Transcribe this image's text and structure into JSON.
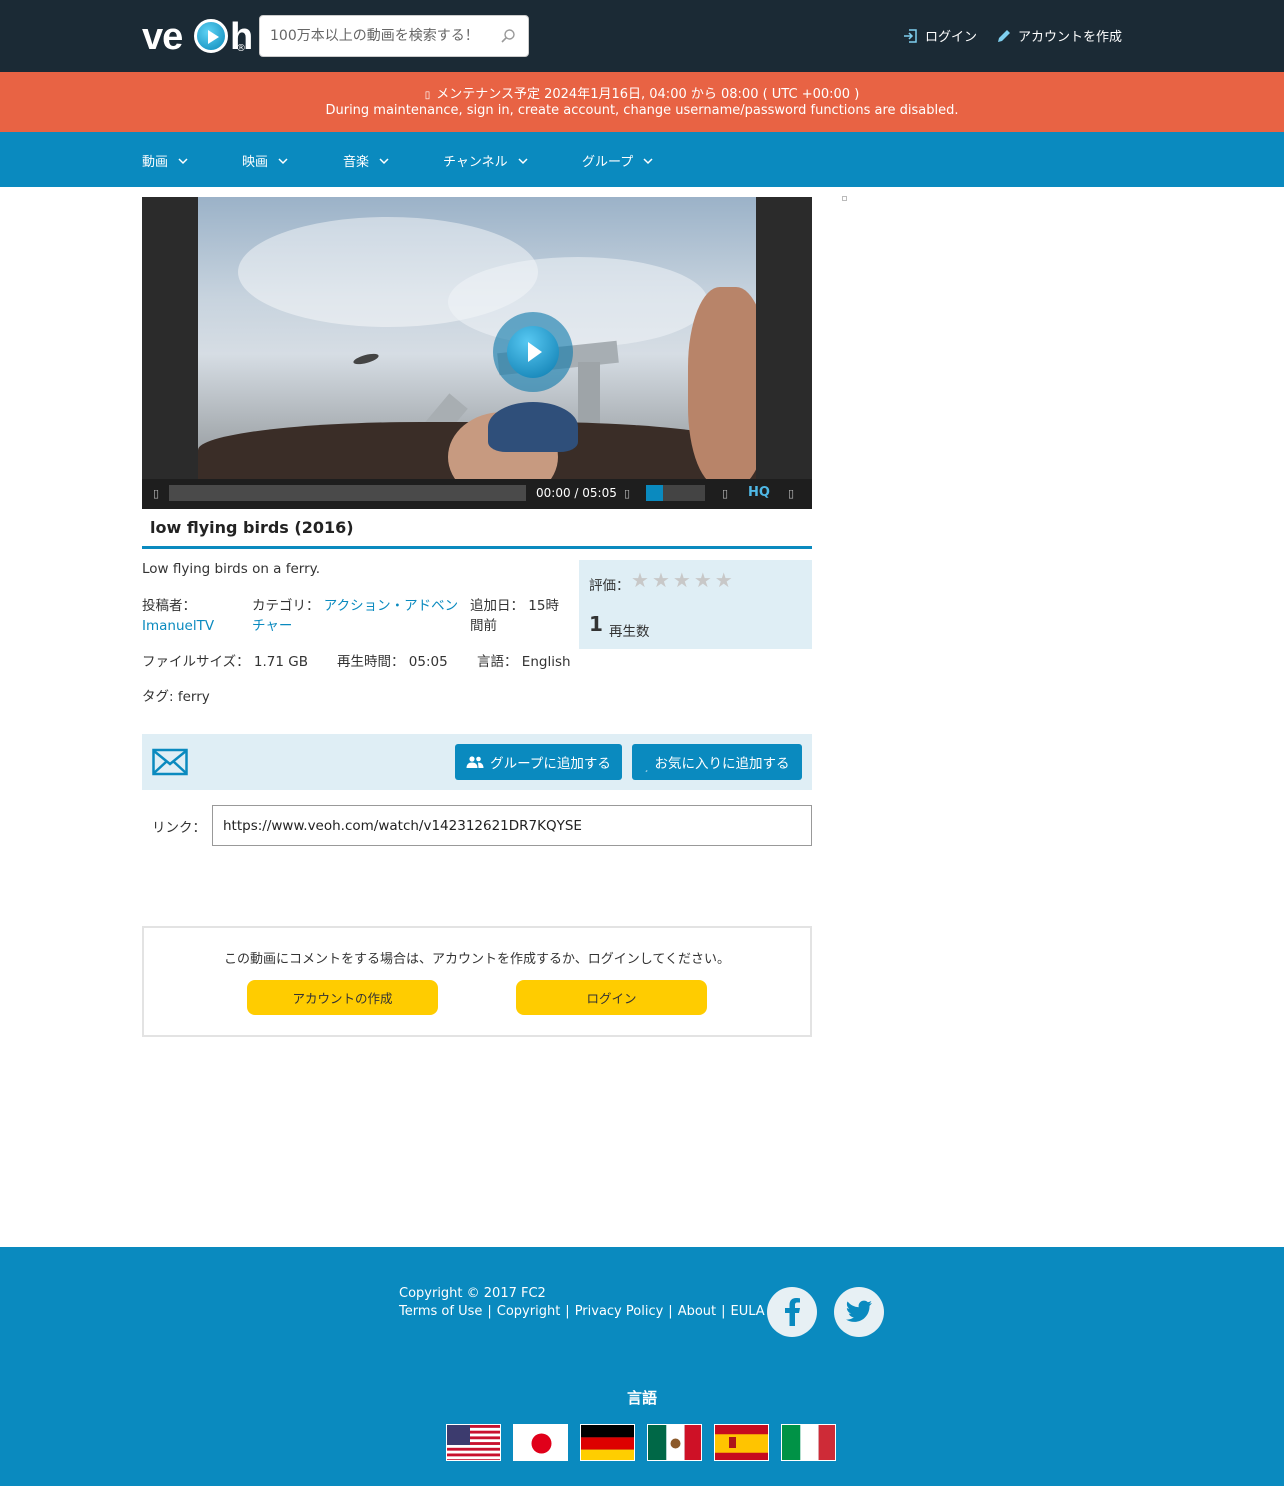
{
  "header": {
    "logo_text": "ve",
    "logo_text_end": "h",
    "logo_reg": "®",
    "search_placeholder": "100万本以上の動画を検索する！",
    "login_label": "ログイン",
    "signup_label": "アカウントを作成"
  },
  "maintenance": {
    "line1": "メンテナンス予定 2024年1月16日, 04:00 から 08:00 ( UTC +00:00 )",
    "line2": "During maintenance, sign in, create account, change username/password functions are disabled."
  },
  "nav": {
    "items": [
      {
        "label": "動画"
      },
      {
        "label": "映画"
      },
      {
        "label": "音楽"
      },
      {
        "label": "チャンネル"
      },
      {
        "label": "グループ"
      }
    ]
  },
  "player": {
    "time": "00:00 / 05:05",
    "hq_label": "HQ",
    "volume_fraction": 0.28,
    "progress_fraction": 0
  },
  "video": {
    "title": "low flying birds (2016)",
    "description": "Low flying birds on a ferry.",
    "uploader_label": "投稿者：",
    "uploader": "ImanuelTV",
    "category_label": "カテゴリ：",
    "category_line1": "アクション・アドベン",
    "category_line2": "チャー",
    "added_label": "追加日：",
    "added_line1": "15時",
    "added_line2": "間前",
    "filesize_label": "ファイルサイズ：",
    "filesize": "1.71 GB",
    "duration_label": "再生時間：",
    "duration": "05:05",
    "language_label": "言語：",
    "language": "English",
    "tags_label": "タグ:",
    "tags": "ferry",
    "rating_label": "評価：",
    "rating_value": 0,
    "rating_max": 5,
    "views": "1",
    "views_label": "再生数"
  },
  "actions": {
    "add_group": "グループに追加する",
    "add_favorite": "お気に入りに追加する",
    "link_label": "リンク：",
    "link_url": "https://www.veoh.com/watch/v142312621DR7KQYSE"
  },
  "comments": {
    "message": "この動画にコメントをする場合は、アカウントを作成するか、ログインしてください。",
    "create_account": "アカウントの作成",
    "login": "ログイン"
  },
  "footer": {
    "copyright": "Copyright © 2017 FC2",
    "links": [
      "Terms of Use",
      "Copyright",
      "Privacy Policy",
      "About",
      "EULA"
    ],
    "language_title": "言語",
    "flags": [
      "us-flag-icon",
      "jp-flag-icon",
      "de-flag-icon",
      "mx-flag-icon",
      "es-flag-icon",
      "it-flag-icon"
    ]
  },
  "colors": {
    "header_bg": "#1b2a35",
    "maintenance_bg": "#e86344",
    "brand_blue": "#0a8abf",
    "panel_light": "#dfeef5",
    "button_yellow": "#ffcc00"
  }
}
